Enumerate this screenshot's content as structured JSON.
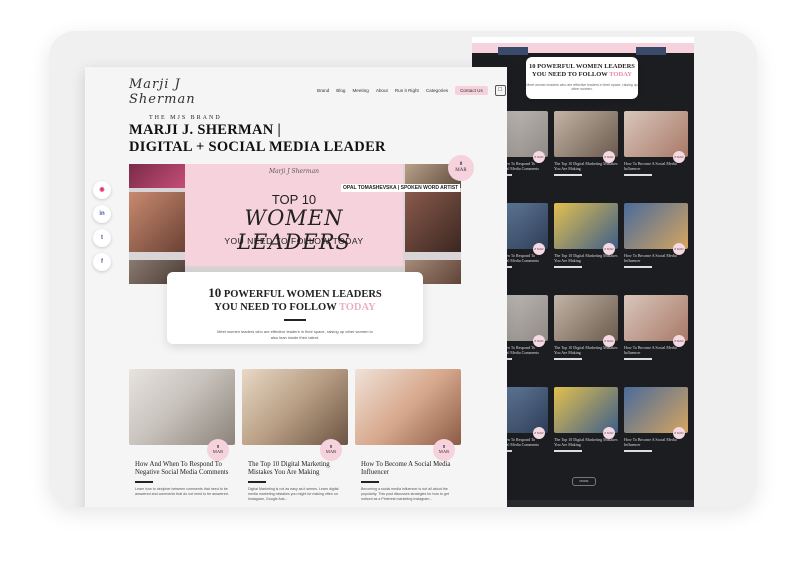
{
  "front": {
    "logo": {
      "script": "Marji J Sherman",
      "sub": "THE MJS BRAND"
    },
    "nav": [
      "Brand",
      "Blog",
      "Meeting",
      "About",
      "Run it Right",
      "Categories"
    ],
    "contact_label": "Contact Us",
    "headline_line1": "MARJI J. SHERMAN |",
    "headline_line2": "DIGITAL + SOCIAL MEDIA LEADER",
    "hero": {
      "mark": "Marji J Sherman",
      "top10": "TOP 10",
      "women": "WOMEN LEADERS",
      "follow": "YOU NEED TO FOLLOW TODAY",
      "caption": "OPAL TOMASHEVSKA | SPOKEN WORD ARTIST",
      "date_day": "8",
      "date_month": "MAR"
    },
    "featured": {
      "num": "10",
      "line1": "POWERFUL WOMEN LEADERS",
      "line2a": "YOU NEED TO FOLLOW",
      "line2b": "TODAY",
      "desc": "Meet women leaders who are effective leaders in their space, raising up other women to also lean inside their talent."
    },
    "posts": [
      {
        "title": "How And When To Respond To Negative Social Media Comments",
        "excerpt": "Learn how to decipher between comments that need to be answered and comments that do not need to be answered.",
        "day": "8",
        "month": "MAR"
      },
      {
        "title": "The Top 10 Digital Marketing Mistakes You Are Making",
        "excerpt": "Digital Marketing is not as easy as it seems. Learn digital media marketing mistakes you might be making often on Instagram, Google Ads...",
        "day": "8",
        "month": "MAR"
      },
      {
        "title": "How To Become A Social Media Influencer",
        "excerpt": "Becoming a social media influencer is not all about the popularity. This post discusses strategies for how to get noticed as a Pinterest marketing Instagram...",
        "day": "8",
        "month": "MAR"
      }
    ]
  },
  "back": {
    "featured_line1": "10 POWERFUL WOMEN LEADERS",
    "featured_line2a": "YOU NEED TO FOLLOW",
    "featured_line2b": "TODAY",
    "featured_desc": "Meet women leaders who are effective leaders in their space, raising up other women.",
    "more_label": "MORE",
    "titles": [
      "How And When To Respond To Negative Social Media Comments",
      "The Top 10 Digital Marketing Mistakes You Are Making",
      "How To Become A Social Media Influencer"
    ]
  },
  "social_icons": [
    "instagram-icon",
    "linkedin-icon",
    "twitter-icon",
    "facebook-icon"
  ],
  "colors": {
    "accent_pink": "#f6d2dd",
    "dark": "#1c1d20"
  }
}
